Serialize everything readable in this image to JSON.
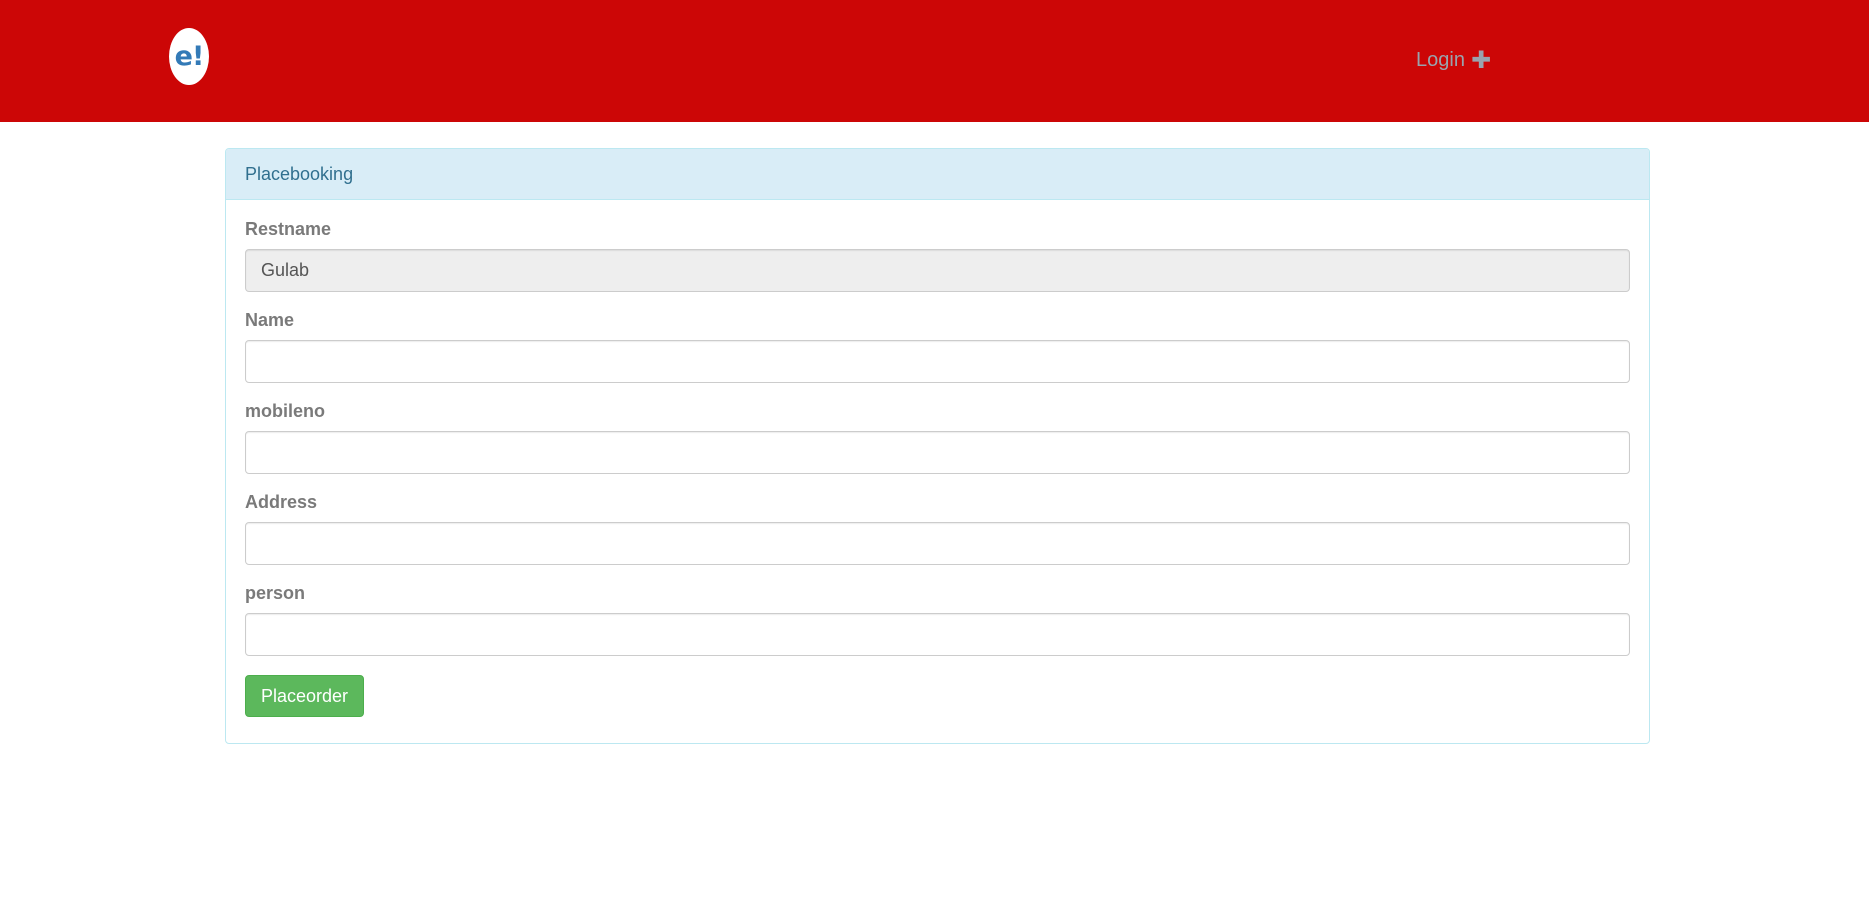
{
  "header": {
    "logo_text": "e!",
    "login_label": "Login",
    "login_icon": "plus-icon",
    "background_color": "#cc0606"
  },
  "panel": {
    "title": "Placebooking",
    "fields": {
      "restname": {
        "label": "Restname",
        "value": "Gulab"
      },
      "name": {
        "label": "Name",
        "value": ""
      },
      "mobileno": {
        "label": "mobileno",
        "value": ""
      },
      "address": {
        "label": "Address",
        "value": ""
      },
      "person": {
        "label": "person",
        "value": ""
      }
    },
    "submit_label": "Placeorder"
  },
  "colors": {
    "panel_heading_bg": "#d9edf7",
    "panel_heading_text": "#31708f",
    "button_success": "#5cb85c"
  }
}
